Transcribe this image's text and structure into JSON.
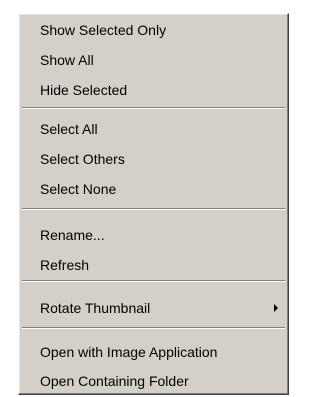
{
  "menu": {
    "show_selected_only": "Show Selected Only",
    "show_all": "Show All",
    "hide_selected": "Hide Selected",
    "select_all": "Select All",
    "select_others": "Select Others",
    "select_none": "Select None",
    "rename": "Rename...",
    "refresh": "Refresh",
    "rotate_thumbnail": "Rotate Thumbnail",
    "open_with_image_application": "Open with Image Application",
    "open_containing_folder": "Open Containing Folder"
  },
  "icons": {
    "submenu_arrow": "chevron-right-icon"
  }
}
